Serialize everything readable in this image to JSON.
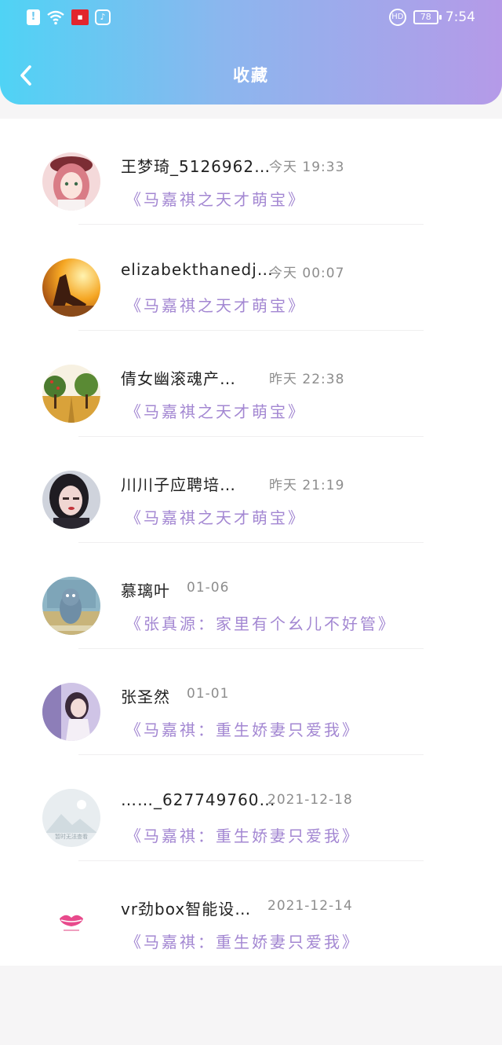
{
  "status": {
    "time": "7:54",
    "battery": "78",
    "network_badge": "HD"
  },
  "header": {
    "title": "收藏"
  },
  "items": [
    {
      "name": "王梦琦_5126962…",
      "time": "今天 19:33",
      "work": "《马嘉祺之天才萌宝》"
    },
    {
      "name": "elizabekthanedj…",
      "time": "今天 00:07",
      "work": "《马嘉祺之天才萌宝》"
    },
    {
      "name": "倩女幽滚魂产…",
      "time": "昨天 22:38",
      "work": "《马嘉祺之天才萌宝》"
    },
    {
      "name": "川川子应聘培…",
      "time": "昨天 21:19",
      "work": "《马嘉祺之天才萌宝》"
    },
    {
      "name": "慕璃叶",
      "time": "01-06",
      "work": "《张真源：家里有个幺儿不好管》"
    },
    {
      "name": "张圣然",
      "time": "01-01",
      "work": "《马嘉祺：重生娇妻只爱我》"
    },
    {
      "name": "……_627749760…",
      "time": "2021-12-18",
      "work": "《马嘉祺：重生娇妻只爱我》",
      "avatar_caption": "暂时无法查看"
    },
    {
      "name": "vr劲box智能设…",
      "time": "2021-12-14",
      "work": "《马嘉祺：重生娇妻只爱我》"
    }
  ],
  "colors": {
    "accent": "#a387d2",
    "header_start": "#4fd3f5",
    "header_end": "#b59ae8"
  }
}
